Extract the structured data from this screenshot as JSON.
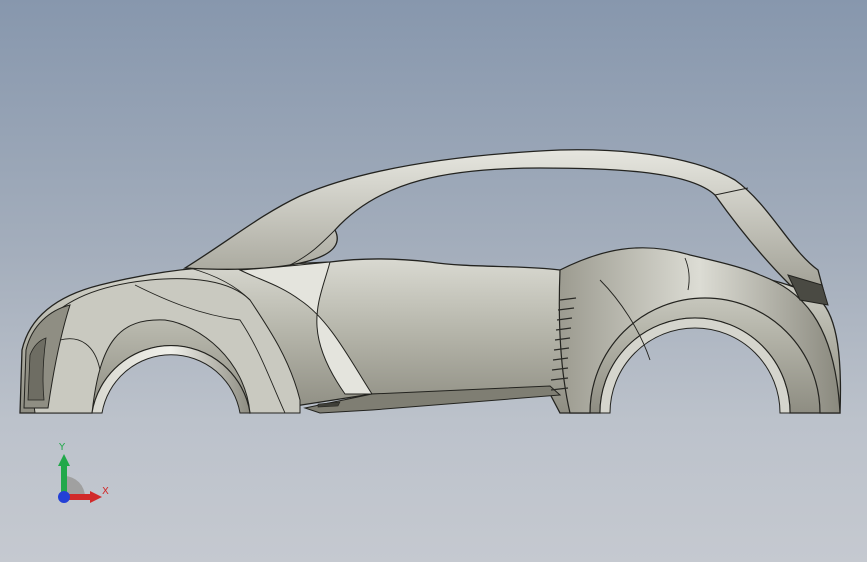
{
  "viewport": {
    "background_top": "#8797ad",
    "background_bottom": "#c5c9d0"
  },
  "model": {
    "body_color": "#b5b5aa",
    "shadow_color": "#7d7c71",
    "highlight_color": "#ecece6",
    "edge_color": "#23231f"
  },
  "triad": {
    "x_label": "X",
    "y_label": "Y",
    "x_color": "#d12a2a",
    "y_color": "#21a84a",
    "z_color": "#2340d6"
  }
}
